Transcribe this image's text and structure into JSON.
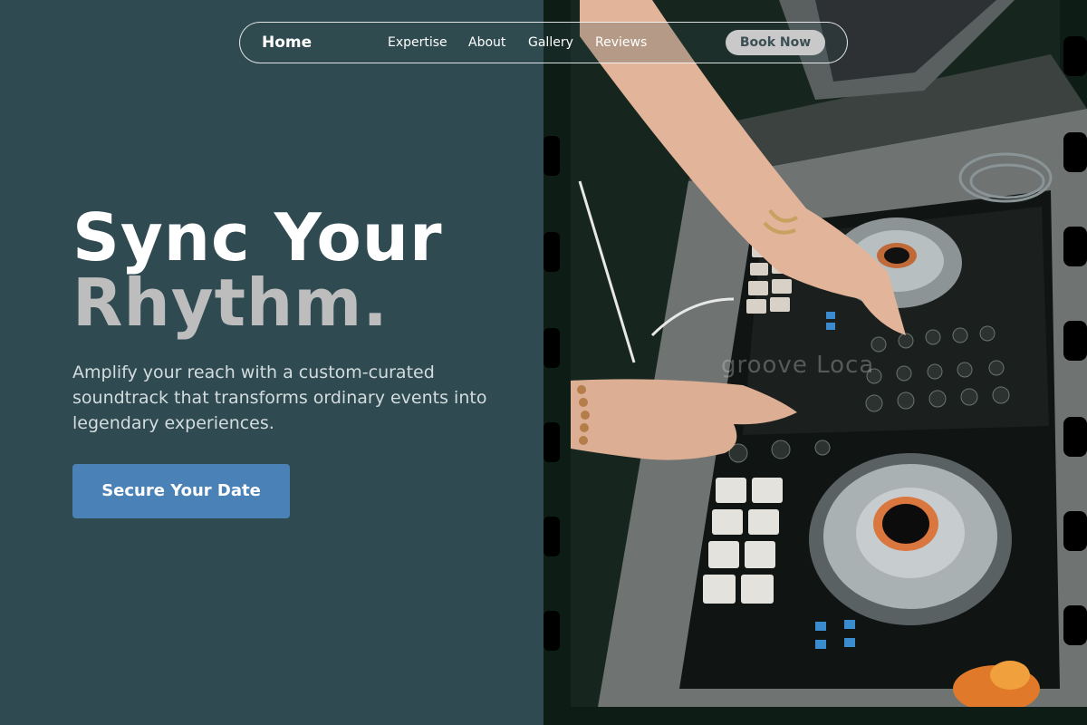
{
  "nav": {
    "home": "Home",
    "links": [
      "Expertise",
      "About",
      "Gallery",
      "Reviews"
    ],
    "book_label": "Book Now"
  },
  "hero": {
    "title_line1": "Sync Your",
    "title_line2": "Rhythm.",
    "subtitle": "Amplify your reach with a custom-curated soundtrack that transforms ordinary events into legendary experiences.",
    "cta_label": "Secure Your Date"
  },
  "photo": {
    "watermark": "groove Loca"
  },
  "colors": {
    "background": "#2f4b51",
    "accent": "#4a82b8",
    "title_secondary": "#bdbdbd"
  }
}
